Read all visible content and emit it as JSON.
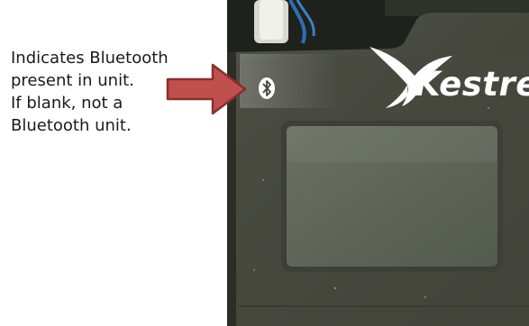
{
  "caption": {
    "lines": [
      "Indicates Bluetooth",
      "present in unit.",
      "If blank, not a",
      "Bluetooth unit."
    ]
  },
  "device": {
    "brand": "Kestrel",
    "indicator_icon": "bluetooth-icon"
  },
  "colors": {
    "arrow_fill": "#c0504d",
    "arrow_stroke": "#8b2e2b",
    "device_body": "#45473c",
    "screen": "#5e6558"
  }
}
